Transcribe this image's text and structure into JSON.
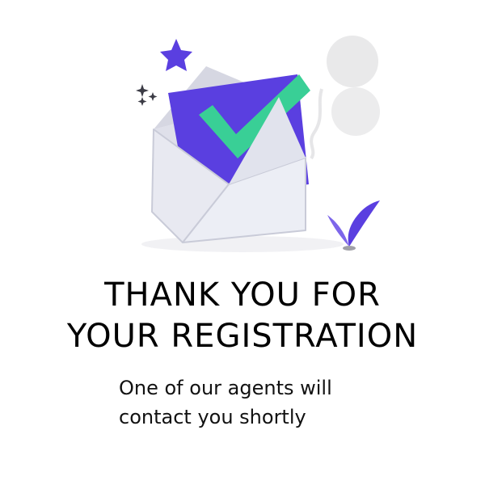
{
  "colors": {
    "accent_purple": "#5a3fe0",
    "check_green": "#39cf96",
    "envelope_gray": "#e6e7ef",
    "envelope_edge": "#c7c9d6",
    "balloon_gray": "#e9e9ea"
  },
  "icons": {
    "star": "star-icon",
    "sparkles": "sparkles-icon",
    "check": "check-icon",
    "envelope": "envelope-icon",
    "plant": "plant-icon",
    "balloons": "balloons-icon"
  },
  "heading": {
    "line1": "THANK YOU FOR",
    "line2": "YOUR REGISTRATION"
  },
  "message": {
    "line1": "One of our agents will",
    "line2": "contact you shortly"
  }
}
